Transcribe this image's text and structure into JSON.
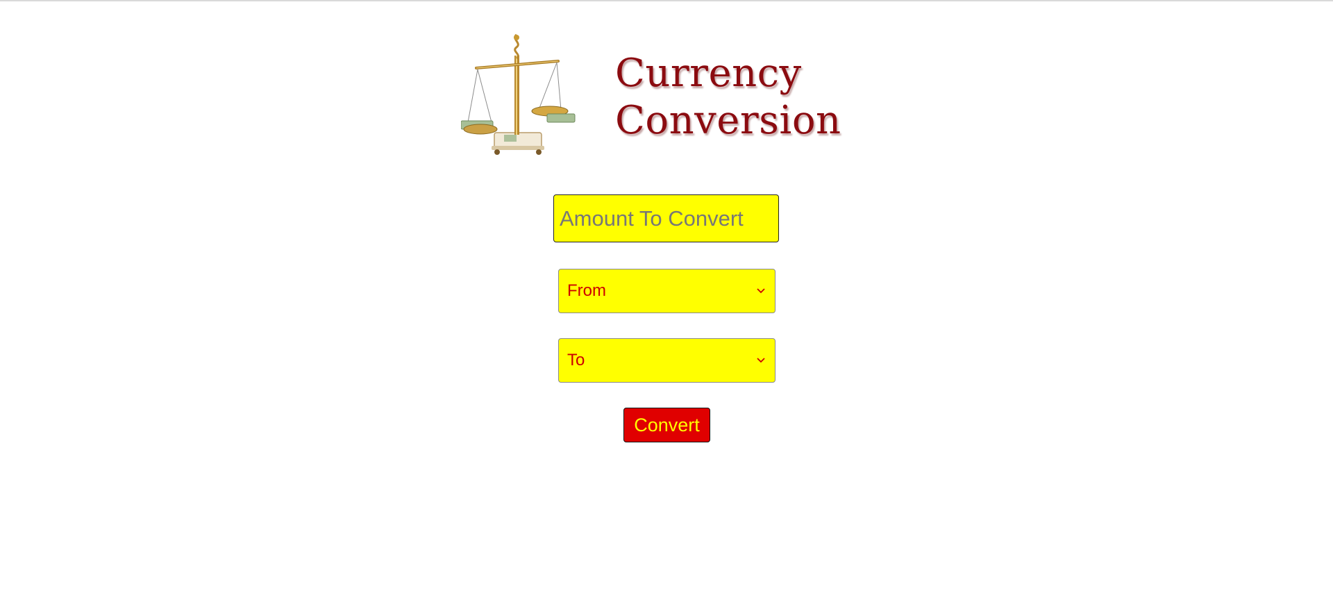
{
  "header": {
    "title_line1": "Currency",
    "title_line2": "Conversion",
    "logo_icon": "balance-scale-with-money-icon"
  },
  "form": {
    "amount": {
      "placeholder": "Amount To Convert",
      "value": ""
    },
    "from_select": {
      "selected_label": "From"
    },
    "to_select": {
      "selected_label": "To"
    },
    "convert_label": "Convert"
  },
  "colors": {
    "field_background": "#ffff00",
    "select_text": "#cc0000",
    "button_background": "#e00000",
    "button_text": "#ffff00",
    "title_color": "#8b0b10"
  }
}
